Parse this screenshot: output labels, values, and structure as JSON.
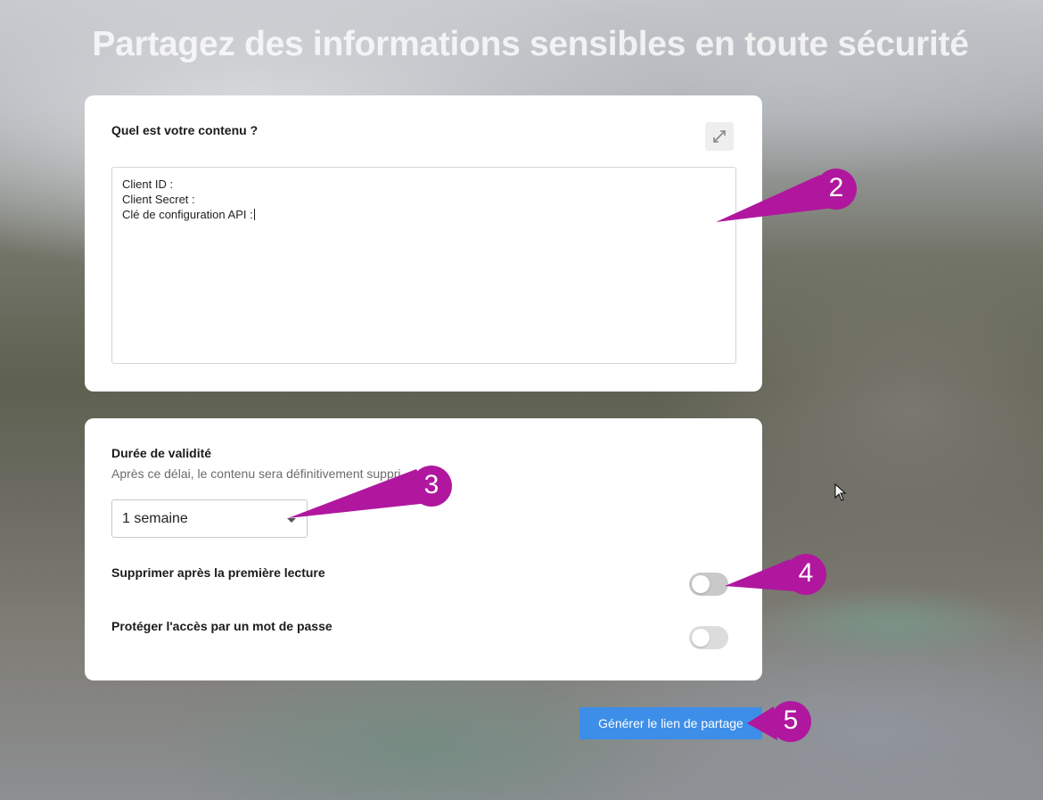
{
  "page": {
    "title": "Partagez des informations sensibles en toute sécurité"
  },
  "content_card": {
    "label": "Quel est votre contenu ?",
    "expand_icon": "expand-icon",
    "textarea_lines": [
      "Client ID :",
      "Client Secret :",
      "Clé de configuration API :"
    ]
  },
  "options_card": {
    "duration_label": "Durée de validité",
    "duration_hint": "Après ce délai, le contenu sera définitivement suppri",
    "duration_value": "1 semaine",
    "delete_after_read_label": "Supprimer après la première lecture",
    "delete_after_read_on": false,
    "password_label": "Protéger l'accès par un mot de passe",
    "password_on": false
  },
  "generate_button": {
    "label": "Générer le lien de partage",
    "color": "#3d8ee8"
  },
  "callouts": {
    "c2": "2",
    "c3": "3",
    "c4": "4",
    "c5": "5",
    "color": "#b0179e"
  }
}
